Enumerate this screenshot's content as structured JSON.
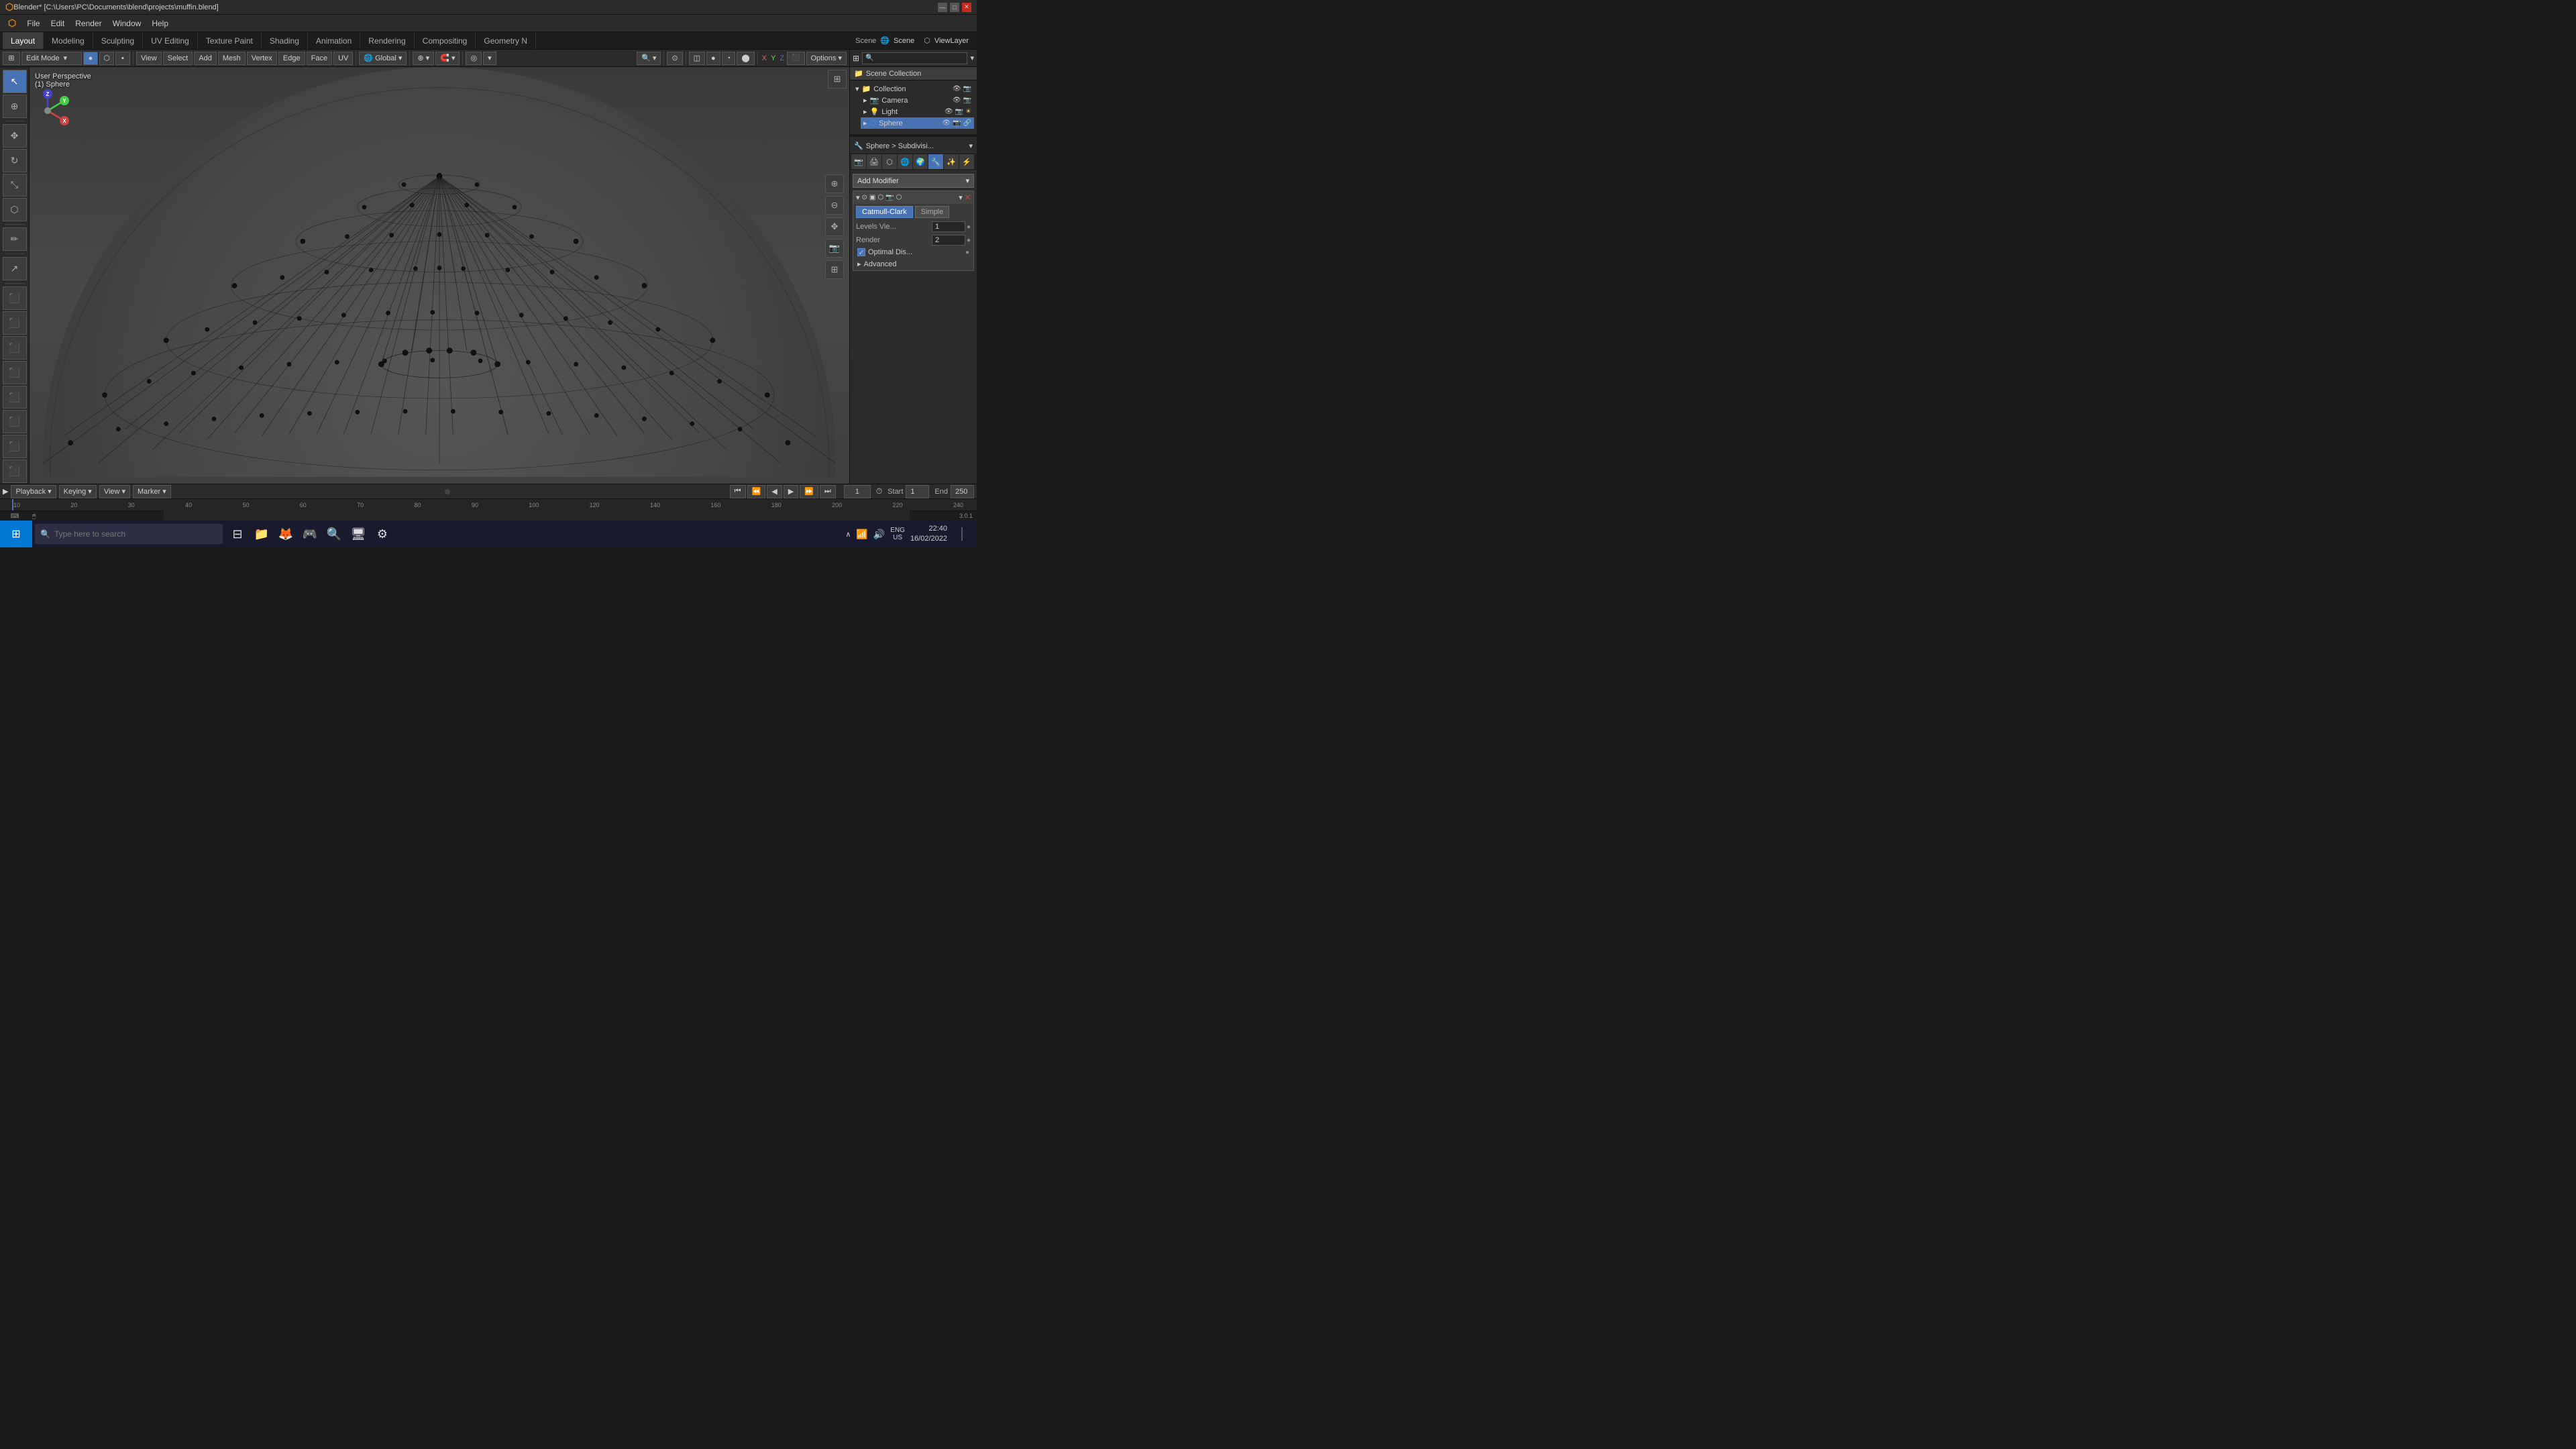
{
  "titlebar": {
    "logo": "⬡",
    "title": "Blender*  [C:\\Users\\PC\\Documents\\blend\\projects\\muffin.blend]",
    "min": "—",
    "max": "□",
    "close": "✕"
  },
  "menubar": {
    "items": [
      "Blender",
      "File",
      "Edit",
      "Render",
      "Window",
      "Help"
    ]
  },
  "workspace_tabs": {
    "tabs": [
      "Layout",
      "Modeling",
      "Sculpting",
      "UV Editing",
      "Texture Paint",
      "Shading",
      "Animation",
      "Rendering",
      "Compositing",
      "Geometry N"
    ],
    "active": "Layout"
  },
  "viewport_toolbar": {
    "mode": "Edit Mode",
    "view": "View",
    "select": "Select",
    "add": "Add",
    "mesh": "Mesh",
    "vertex": "Vertex",
    "edge": "Edge",
    "face": "Face",
    "uv": "UV",
    "transform": "Global",
    "overlay_btn": "⊙",
    "xray_btn": "◎"
  },
  "viewport_sub_toolbar": {
    "btns": [
      "▣",
      "▤",
      "▦",
      "▥",
      "▧"
    ]
  },
  "left_tools": {
    "tools": [
      "↖",
      "⊕",
      "✥",
      "↔",
      "⟳",
      "□",
      "⬡",
      "▼",
      "△",
      "◉",
      "✏",
      "↗",
      "⬛",
      "⬛",
      "⬛",
      "⬛",
      "⬛",
      "⬛"
    ]
  },
  "viewport_info": {
    "perspective": "User Perspective",
    "object": "(1) Sphere"
  },
  "gizmo": {
    "x_label": "X",
    "y_label": "Y",
    "z_label": "Z"
  },
  "right_panel": {
    "header": {
      "scene_label": "Scene",
      "viewlayer_label": "ViewLayer"
    },
    "breadcrumb": {
      "scene_collection": "Scene Collection"
    },
    "hierarchy": {
      "root": "Collection",
      "items": [
        {
          "name": "Camera",
          "icon": "📷",
          "indent": 1
        },
        {
          "name": "Light",
          "icon": "💡",
          "indent": 1
        },
        {
          "name": "Sphere",
          "icon": "⬡",
          "indent": 1,
          "active": true
        }
      ]
    },
    "modifier_section": {
      "breadcrumb": "Sphere > Subdivisi...",
      "add_modifier_label": "Add Modifier",
      "type_btns": [
        "Catmull-Clark",
        "Simple"
      ],
      "active_type": "Catmull-Clark",
      "levels_viewport_label": "Levels Vie...",
      "levels_viewport_value": "1",
      "render_label": "Render",
      "render_value": "2",
      "optimal_display_label": "Optimal Dis...",
      "optimal_display_checked": true,
      "advanced_label": "Advanced"
    }
  },
  "timeline": {
    "playback_label": "Playback",
    "keying_label": "Keying",
    "view_label": "View",
    "marker_label": "Marker",
    "frame_current": "1",
    "start_label": "Start",
    "start_value": "1",
    "end_label": "End",
    "end_value": "250",
    "frame_numbers": [
      "10",
      "20",
      "30",
      "40",
      "50",
      "60",
      "70",
      "80",
      "90",
      "100",
      "120",
      "140",
      "160",
      "180",
      "200",
      "220",
      "240"
    ]
  },
  "taskbar": {
    "start_icon": "⊞",
    "search_placeholder": "Type here to search",
    "icons": [
      "⊟",
      "📁",
      "🦊",
      "🎮",
      "🔍",
      "🖥",
      "⚙"
    ],
    "time": "22:40",
    "date": "16/02/2022",
    "lang": "ENG",
    "region": "US"
  },
  "statusbar": {
    "version": "3.0.1",
    "keyboard_icon": "⌨",
    "mouse_icon": "🖱",
    "menu_icon": "☰"
  }
}
